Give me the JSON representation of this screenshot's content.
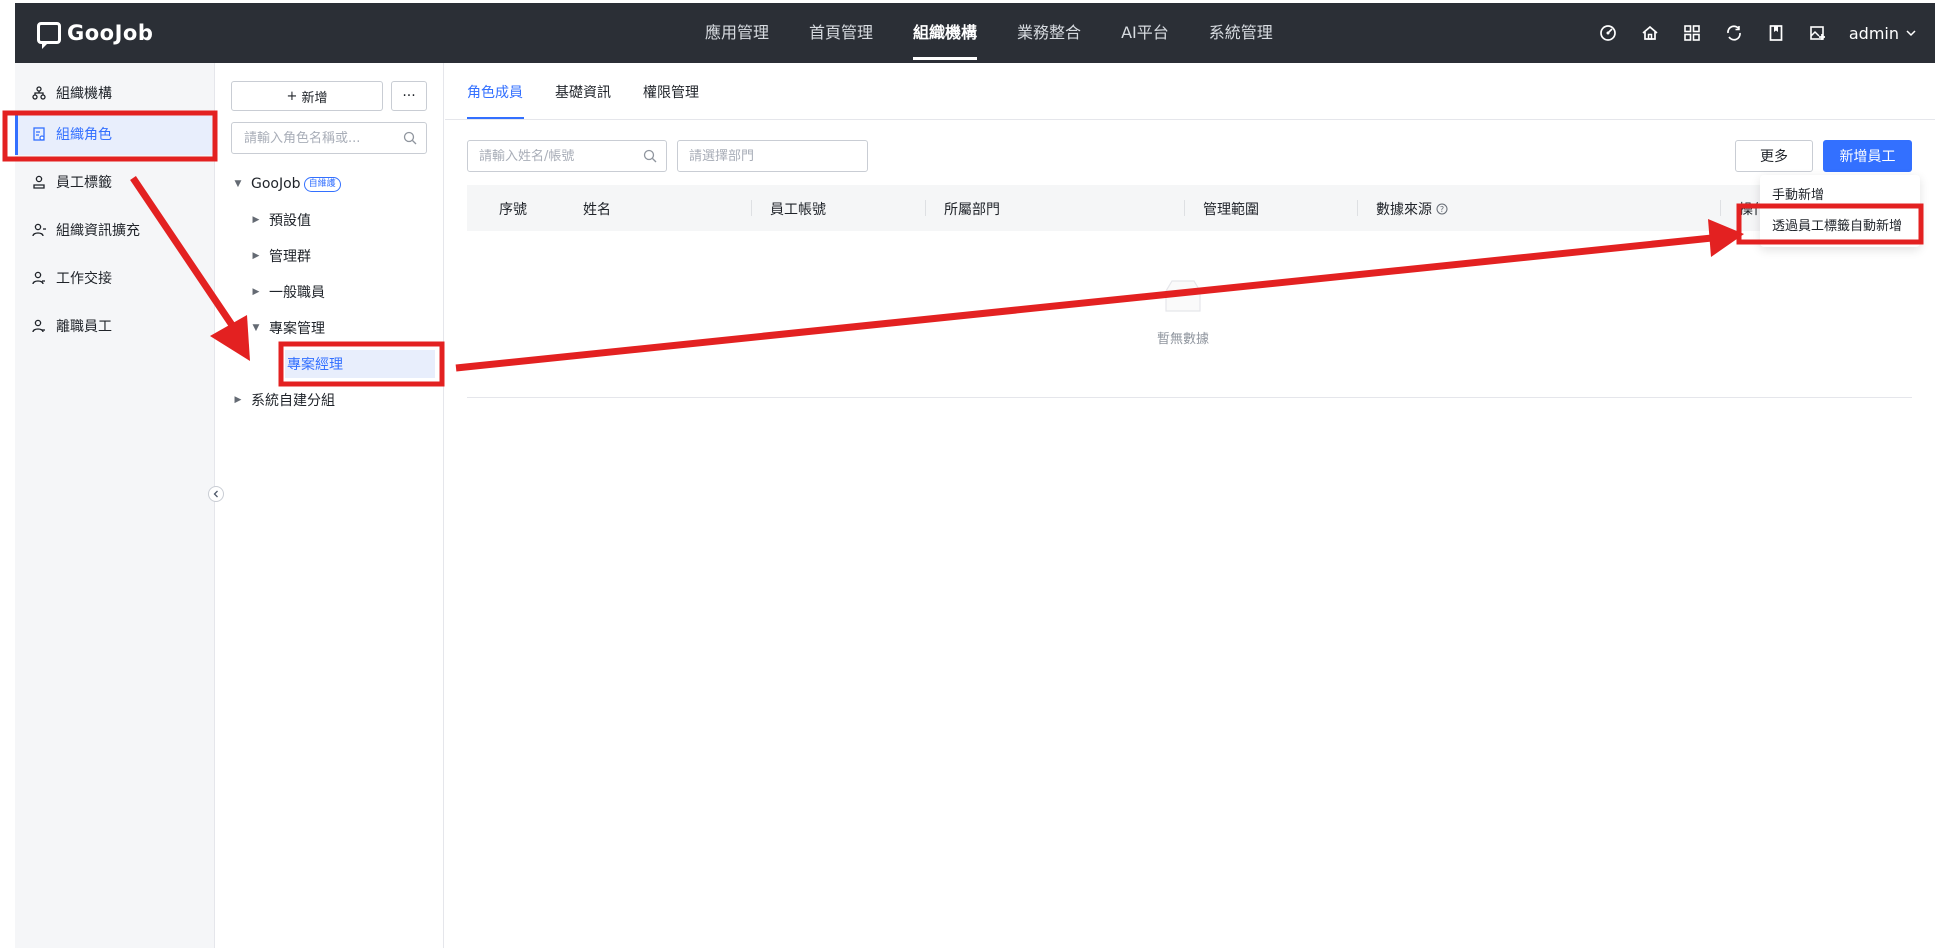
{
  "app": {
    "logo_text": "GooJob"
  },
  "topnav": {
    "items": [
      "應用管理",
      "首頁管理",
      "組織機構",
      "業務整合",
      "AI平台",
      "系統管理"
    ],
    "active_index": 2,
    "icons": [
      "dashboard-icon",
      "home-icon",
      "apps-grid-icon",
      "sync-icon",
      "bookmark-icon",
      "image-add-icon"
    ],
    "user": "admin"
  },
  "sidebar": {
    "items": [
      {
        "label": "組織機構",
        "icon": "org-tree-icon"
      },
      {
        "label": "組織角色",
        "icon": "role-doc-icon",
        "active": true
      },
      {
        "label": "員工標籤",
        "icon": "user-tag-icon"
      },
      {
        "label": "組織資訊擴充",
        "icon": "user-extend-icon"
      },
      {
        "label": "工作交接",
        "icon": "user-handover-icon"
      },
      {
        "label": "離職員工",
        "icon": "user-leave-icon"
      }
    ]
  },
  "tree": {
    "new_button": "新增",
    "more_button": "···",
    "search_placeholder": "請輸入角色名稱或...",
    "root": {
      "label": "GooJob",
      "badge": "自維護"
    },
    "nodes": [
      "預設值",
      "管理群",
      "一般職員",
      "專案管理",
      "專案經理",
      "系統自建分組"
    ]
  },
  "main": {
    "tabs": [
      "角色成員",
      "基礎資訊",
      "權限管理"
    ],
    "active_tab": 0,
    "filters": {
      "name_placeholder": "請輸入姓名/帳號",
      "dept_placeholder": "請選擇部門"
    },
    "buttons": {
      "more": "更多",
      "add_employee": "新增員工"
    },
    "table_headers": [
      "序號",
      "姓名",
      "員工帳號",
      "所屬部門",
      "管理範圍",
      "數據來源",
      "操作"
    ],
    "empty_text": "暫無數據",
    "dropdown": [
      "手動新增",
      "透過員工標籤自動新增"
    ]
  },
  "annotation_color": "#e32121"
}
